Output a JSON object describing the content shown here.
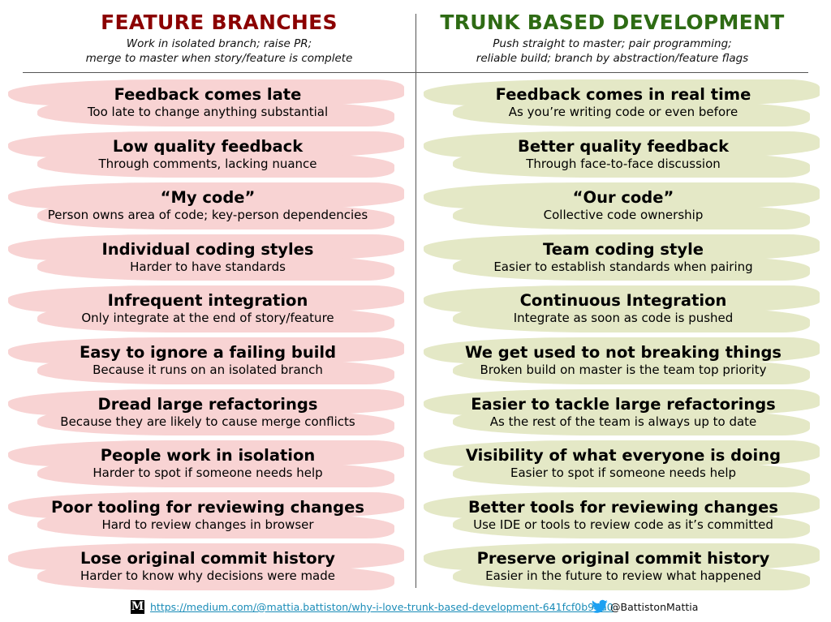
{
  "left": {
    "title": "FEATURE BRANCHES",
    "subtitle_line1": "Work in isolated branch; raise PR;",
    "subtitle_line2": "merge to master when story/feature is complete",
    "color": "#8b0000",
    "brush_color": "#f8d3d3",
    "items": [
      {
        "title": "Feedback comes late",
        "sub": "Too late to change anything substantial"
      },
      {
        "title": "Low quality feedback",
        "sub": "Through comments, lacking nuance"
      },
      {
        "title": "“My code”",
        "sub": "Person owns area of code; key-person dependencies"
      },
      {
        "title": "Individual coding styles",
        "sub": "Harder to have standards"
      },
      {
        "title": "Infrequent integration",
        "sub": "Only integrate at the end of story/feature"
      },
      {
        "title": "Easy to ignore a failing build",
        "sub": "Because it runs on an isolated branch"
      },
      {
        "title": "Dread large refactorings",
        "sub": "Because they are likely to cause merge conflicts"
      },
      {
        "title": "People work in isolation",
        "sub": "Harder to spot if someone needs help"
      },
      {
        "title": "Poor tooling for reviewing changes",
        "sub": "Hard to review changes in browser"
      },
      {
        "title": "Lose original commit history",
        "sub": "Harder to know why decisions were made"
      }
    ]
  },
  "right": {
    "title": "TRUNK BASED DEVELOPMENT",
    "subtitle_line1": "Push straight to master; pair programming;",
    "subtitle_line2": "reliable build; branch by abstraction/feature flags",
    "color": "#2e6b14",
    "brush_color": "#e4e8c6",
    "items": [
      {
        "title": "Feedback comes in real time",
        "sub": "As you’re writing code or even before"
      },
      {
        "title": "Better quality feedback",
        "sub": "Through face-to-face discussion"
      },
      {
        "title": "“Our code”",
        "sub": "Collective code ownership"
      },
      {
        "title": "Team coding style",
        "sub": "Easier to establish standards when pairing"
      },
      {
        "title": "Continuous Integration",
        "sub": "Integrate as soon as code is pushed"
      },
      {
        "title": "We get used to not breaking things",
        "sub": "Broken build on master is the team top priority"
      },
      {
        "title": "Easier to tackle large refactorings",
        "sub": "As the rest of the team is always up to date"
      },
      {
        "title": "Visibility of what everyone is doing",
        "sub": "Easier to spot if someone needs help"
      },
      {
        "title": "Better tools for reviewing changes",
        "sub": "Use IDE or tools to review code as it’s committed"
      },
      {
        "title": "Preserve original commit history",
        "sub": "Easier in the future to review what happened"
      }
    ]
  },
  "footer": {
    "medium_logo": "M",
    "medium_icon": "medium-logo-icon",
    "link": "https://medium.com/@mattia.battiston/why-i-love-trunk-based-development-641fcf0b94a0",
    "twitter_icon": "twitter-bird-icon",
    "handle": "@BattistonMattia",
    "link_color": "#1a8cb8"
  }
}
